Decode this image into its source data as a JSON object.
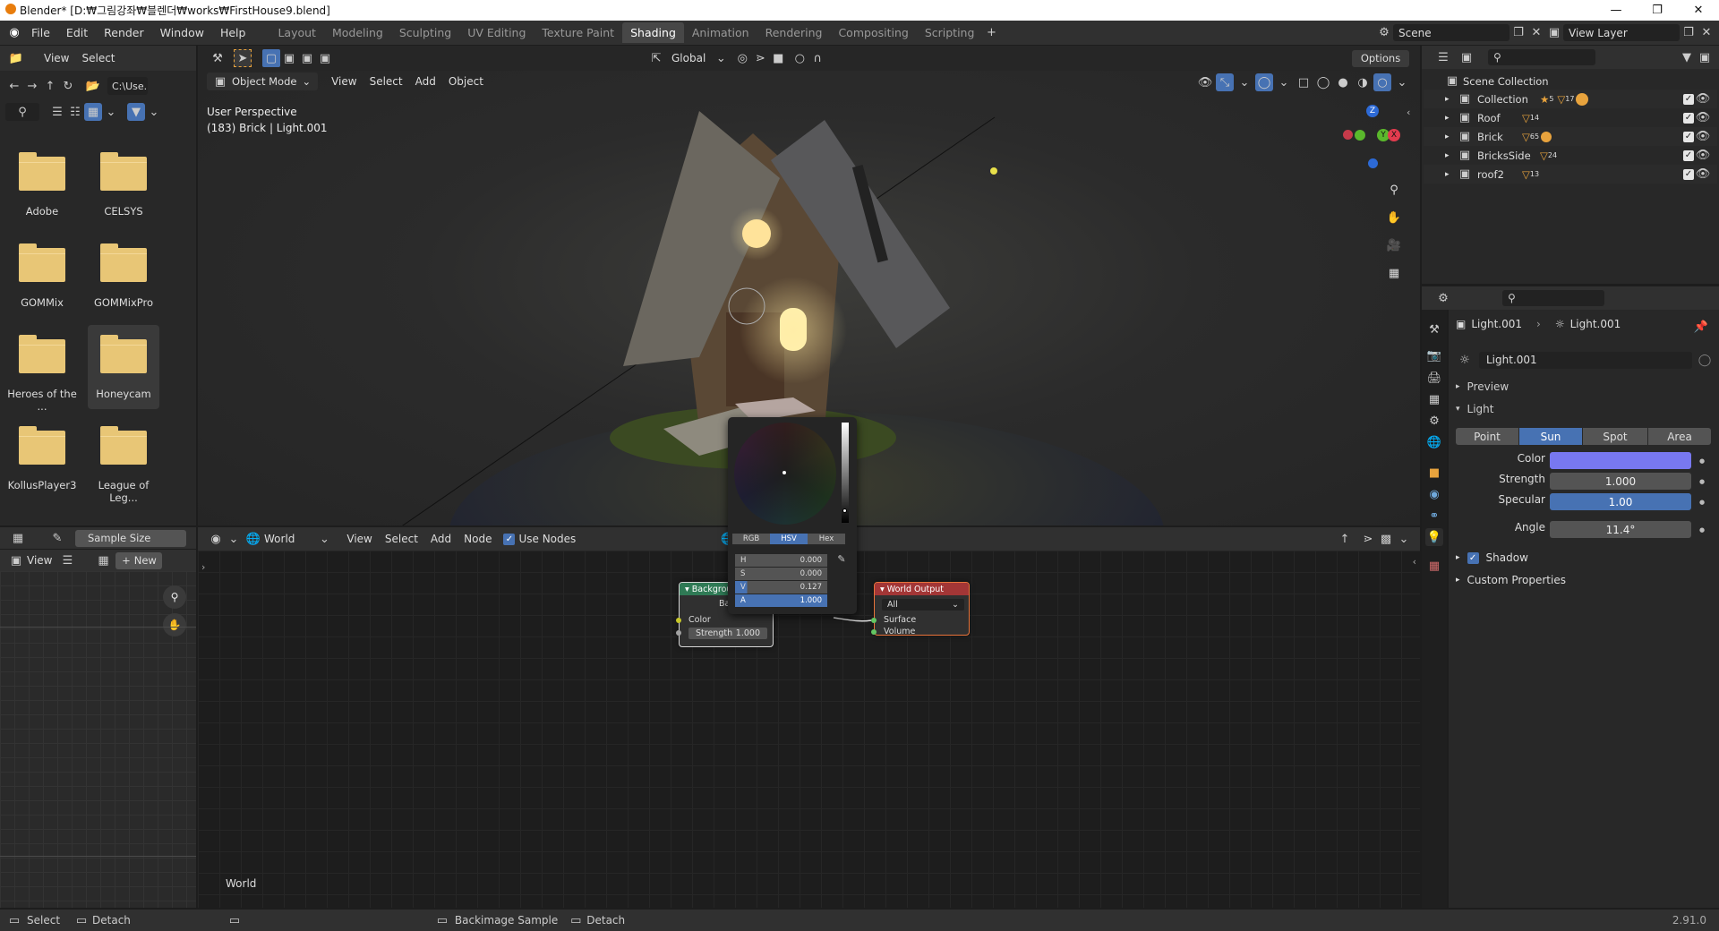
{
  "window": {
    "title": "Blender* [D:₩그림강좌₩블렌더₩works₩FirstHouse9.blend]"
  },
  "top_menu": [
    "File",
    "Edit",
    "Render",
    "Window",
    "Help"
  ],
  "workspaces": [
    "Layout",
    "Modeling",
    "Sculpting",
    "UV Editing",
    "Texture Paint",
    "Shading",
    "Animation",
    "Rendering",
    "Compositing",
    "Scripting"
  ],
  "active_workspace": "Shading",
  "scene": {
    "name": "Scene",
    "view_layer": "View Layer"
  },
  "file_browser": {
    "menu": [
      "View",
      "Select"
    ],
    "path": "C:\\Use...",
    "folders": [
      "Adobe",
      "CELSYS",
      "GOMMix",
      "GOMMixPro",
      "Heroes of the ...",
      "Honeycam",
      "KollusPlayer3",
      "League of Leg..."
    ]
  },
  "viewport": {
    "mode": "Object Mode",
    "menu": [
      "View",
      "Select",
      "Add",
      "Object"
    ],
    "orientation": "Global",
    "options": "Options",
    "perspective": "User Perspective",
    "info": "(183) Brick | Light.001",
    "gizmo_labels": {
      "z": "Z",
      "y": "Y",
      "x": "X"
    }
  },
  "image_editor": {
    "sample_size": "Sample Size",
    "view": "View",
    "new": "New"
  },
  "node_editor": {
    "world_type": "World",
    "menu": [
      "View",
      "Select",
      "Add",
      "Node"
    ],
    "use_nodes": "Use Nodes",
    "world_short": "W",
    "footer_label": "World",
    "background_node": {
      "title": "Backgrou",
      "out": "Bac",
      "color": "Color",
      "strength_label": "Strength",
      "strength": "1.000"
    },
    "output_node": {
      "title": "World Output",
      "target": "All",
      "surface": "Surface",
      "volume": "Volume"
    }
  },
  "color_picker": {
    "tabs": [
      "RGB",
      "HSV",
      "Hex"
    ],
    "active_tab": "HSV",
    "fields": [
      {
        "label": "H",
        "value": "0.000"
      },
      {
        "label": "S",
        "value": "0.000"
      },
      {
        "label": "V",
        "value": "0.127"
      },
      {
        "label": "A",
        "value": "1.000"
      }
    ]
  },
  "outliner": {
    "root": "Scene Collection",
    "items": [
      {
        "name": "Collection",
        "badges": [
          "5",
          "17"
        ]
      },
      {
        "name": "Roof",
        "badges": [
          "14"
        ]
      },
      {
        "name": "Brick",
        "badges": [
          "65"
        ]
      },
      {
        "name": "BricksSide",
        "badges": [
          "24"
        ]
      },
      {
        "name": "roof2",
        "badges": [
          "13"
        ]
      }
    ]
  },
  "properties": {
    "breadcrumb": [
      "Light.001",
      "Light.001"
    ],
    "datablock": "Light.001",
    "panels": {
      "preview": "Preview",
      "light": "Light",
      "shadow": "Shadow",
      "custom": "Custom Properties"
    },
    "light_types": [
      "Point",
      "Sun",
      "Spot",
      "Area"
    ],
    "active_type": "Sun",
    "color_label": "Color",
    "color_value": "#7878f0",
    "strength_label": "Strength",
    "strength": "1.000",
    "specular_label": "Specular",
    "specular": "1.00",
    "angle_label": "Angle",
    "angle": "11.4°"
  },
  "status_bar": {
    "select": "Select",
    "detach": "Detach",
    "backimage": "Backimage Sample",
    "detach2": "Detach",
    "version": "2.91.0"
  }
}
